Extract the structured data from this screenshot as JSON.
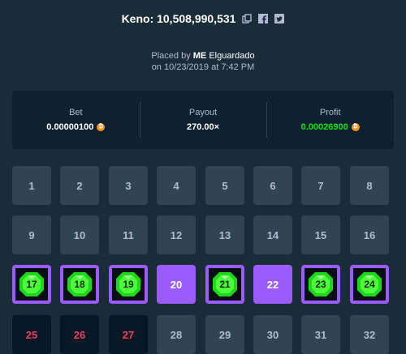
{
  "header": {
    "title": "Keno: 10,508,990,531",
    "placed_by_prefix": "Placed by",
    "rank": "ME",
    "username": "Elguardado",
    "date_line": "on 10/23/2019 at 7:42 PM"
  },
  "stats": {
    "bet_label": "Bet",
    "bet_value": "0.00000100",
    "payout_label": "Payout",
    "payout_value": "270.00×",
    "profit_label": "Profit",
    "profit_value": "0.00026900",
    "currency_icon": "bitcoin-icon",
    "profit_color": "#00e701"
  },
  "tiles": [
    {
      "n": "1",
      "state": "normal"
    },
    {
      "n": "2",
      "state": "normal"
    },
    {
      "n": "3",
      "state": "normal"
    },
    {
      "n": "4",
      "state": "normal"
    },
    {
      "n": "5",
      "state": "normal"
    },
    {
      "n": "6",
      "state": "normal"
    },
    {
      "n": "7",
      "state": "normal"
    },
    {
      "n": "8",
      "state": "normal"
    },
    {
      "n": "9",
      "state": "normal"
    },
    {
      "n": "10",
      "state": "normal"
    },
    {
      "n": "11",
      "state": "normal"
    },
    {
      "n": "12",
      "state": "normal"
    },
    {
      "n": "13",
      "state": "normal"
    },
    {
      "n": "14",
      "state": "normal"
    },
    {
      "n": "15",
      "state": "normal"
    },
    {
      "n": "16",
      "state": "normal"
    },
    {
      "n": "17",
      "state": "hit"
    },
    {
      "n": "18",
      "state": "hit"
    },
    {
      "n": "19",
      "state": "hit"
    },
    {
      "n": "20",
      "state": "picked"
    },
    {
      "n": "21",
      "state": "hit"
    },
    {
      "n": "22",
      "state": "picked"
    },
    {
      "n": "23",
      "state": "hit"
    },
    {
      "n": "24",
      "state": "hit"
    },
    {
      "n": "25",
      "state": "miss"
    },
    {
      "n": "26",
      "state": "miss"
    },
    {
      "n": "27",
      "state": "miss"
    },
    {
      "n": "28",
      "state": "normal"
    },
    {
      "n": "29",
      "state": "normal"
    },
    {
      "n": "30",
      "state": "normal"
    },
    {
      "n": "31",
      "state": "normal"
    },
    {
      "n": "32",
      "state": "normal"
    }
  ]
}
